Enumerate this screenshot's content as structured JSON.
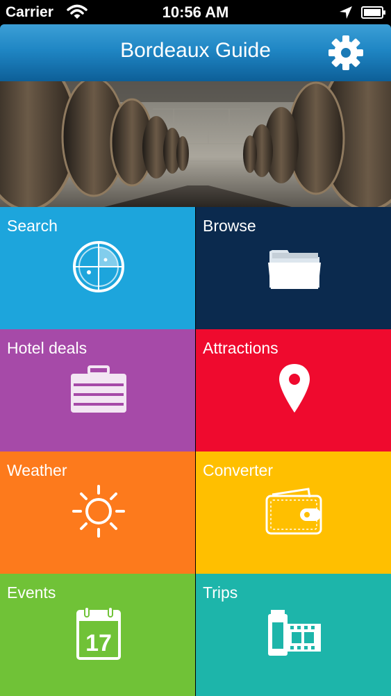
{
  "status_bar": {
    "carrier": "Carrier",
    "time": "10:56 AM"
  },
  "header": {
    "title": "Bordeaux Guide"
  },
  "tiles": [
    {
      "label": "Search",
      "color": "#1da5dc",
      "icon": "radar-icon"
    },
    {
      "label": "Browse",
      "color": "#0b2a4e",
      "icon": "folder-icon"
    },
    {
      "label": "Hotel deals",
      "color": "#a64aa8",
      "icon": "suitcase-icon"
    },
    {
      "label": "Attractions",
      "color": "#ef0a2e",
      "icon": "map-pin-icon"
    },
    {
      "label": "Weather",
      "color": "#fd7a1c",
      "icon": "sun-icon"
    },
    {
      "label": "Converter",
      "color": "#ffbf00",
      "icon": "wallet-icon"
    },
    {
      "label": "Events",
      "color": "#70c237",
      "icon": "calendar-icon",
      "icon_text": "17"
    },
    {
      "label": "Trips",
      "color": "#1db5aa",
      "icon": "film-roll-icon"
    }
  ]
}
